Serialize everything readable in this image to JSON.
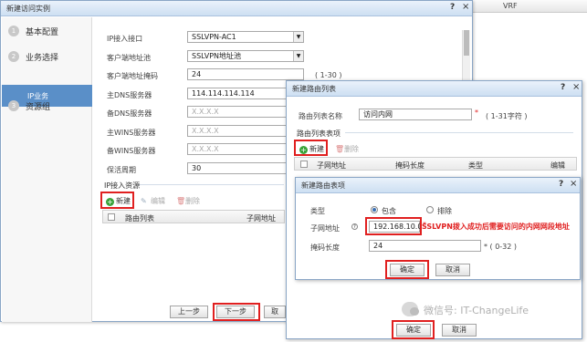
{
  "background": {
    "column_vrf": "VRF"
  },
  "dialog1": {
    "title": "新建访问实例",
    "help": "?",
    "close": "×",
    "steps": [
      {
        "num": "1",
        "label": "基本配置"
      },
      {
        "num": "2",
        "label": "业务选择"
      },
      {
        "label": "IP业务"
      },
      {
        "num": "3",
        "label": "资源组"
      }
    ],
    "fields": {
      "ip_interface_label": "IP接入接口",
      "ip_interface_value": "SSLVPN-AC1",
      "pool_label": "客户端地址池",
      "pool_value": "SSLVPN地址池",
      "mask_label": "客户端地址掩码",
      "mask_value": "24",
      "mask_hint": "( 1-30 )",
      "dns1_label": "主DNS服务器",
      "dns1_value": "114.114.114.114",
      "dns2_label": "备DNS服务器",
      "dns2_placeholder": "X.X.X.X",
      "wins1_label": "主WINS服务器",
      "wins1_placeholder": "X.X.X.X",
      "wins2_label": "备WINS服务器",
      "wins2_placeholder": "X.X.X.X",
      "keepalive_label": "保活周期",
      "keepalive_value": "30"
    },
    "resource_section": "IP接入资源",
    "toolbar": {
      "new": "新建",
      "edit": "编辑",
      "delete": "删除"
    },
    "table_headers": [
      "路由列表",
      "子网地址"
    ],
    "buttons": {
      "prev": "上一步",
      "next": "下一步",
      "cancel": "取"
    }
  },
  "dialog2": {
    "title": "新建路由列表",
    "help": "?",
    "close": "×",
    "name_label": "路由列表名称",
    "name_value": "访问内网",
    "name_required": "*",
    "name_hint": "( 1-31字符 )",
    "section": "路由列表表项",
    "toolbar": {
      "new": "新建",
      "delete": "删除"
    },
    "table_headers": [
      "子网地址",
      "掩码长度",
      "类型",
      "编辑"
    ],
    "buttons": {
      "ok": "确定",
      "cancel": "取消"
    }
  },
  "dialog3": {
    "title": "新建路由表项",
    "help": "?",
    "close": "×",
    "type_label": "类型",
    "type_include": "包含",
    "type_exclude": "排除",
    "subnet_label": "子网地址",
    "subnet_value": "192.168.10.0",
    "subnet_required": "*",
    "mask_label": "掩码长度",
    "mask_value": "24",
    "mask_hint": "* ( 0-32 )",
    "buttons": {
      "ok": "确定",
      "cancel": "取消"
    }
  },
  "annotation": "SSLVPN拨入成功后需要访问的内网网段地址",
  "watermark": "微信号: IT-ChangeLife",
  "colors": {
    "accent": "#5a8fc8",
    "highlight": "#e02020",
    "title_bar": "#cddff2"
  }
}
